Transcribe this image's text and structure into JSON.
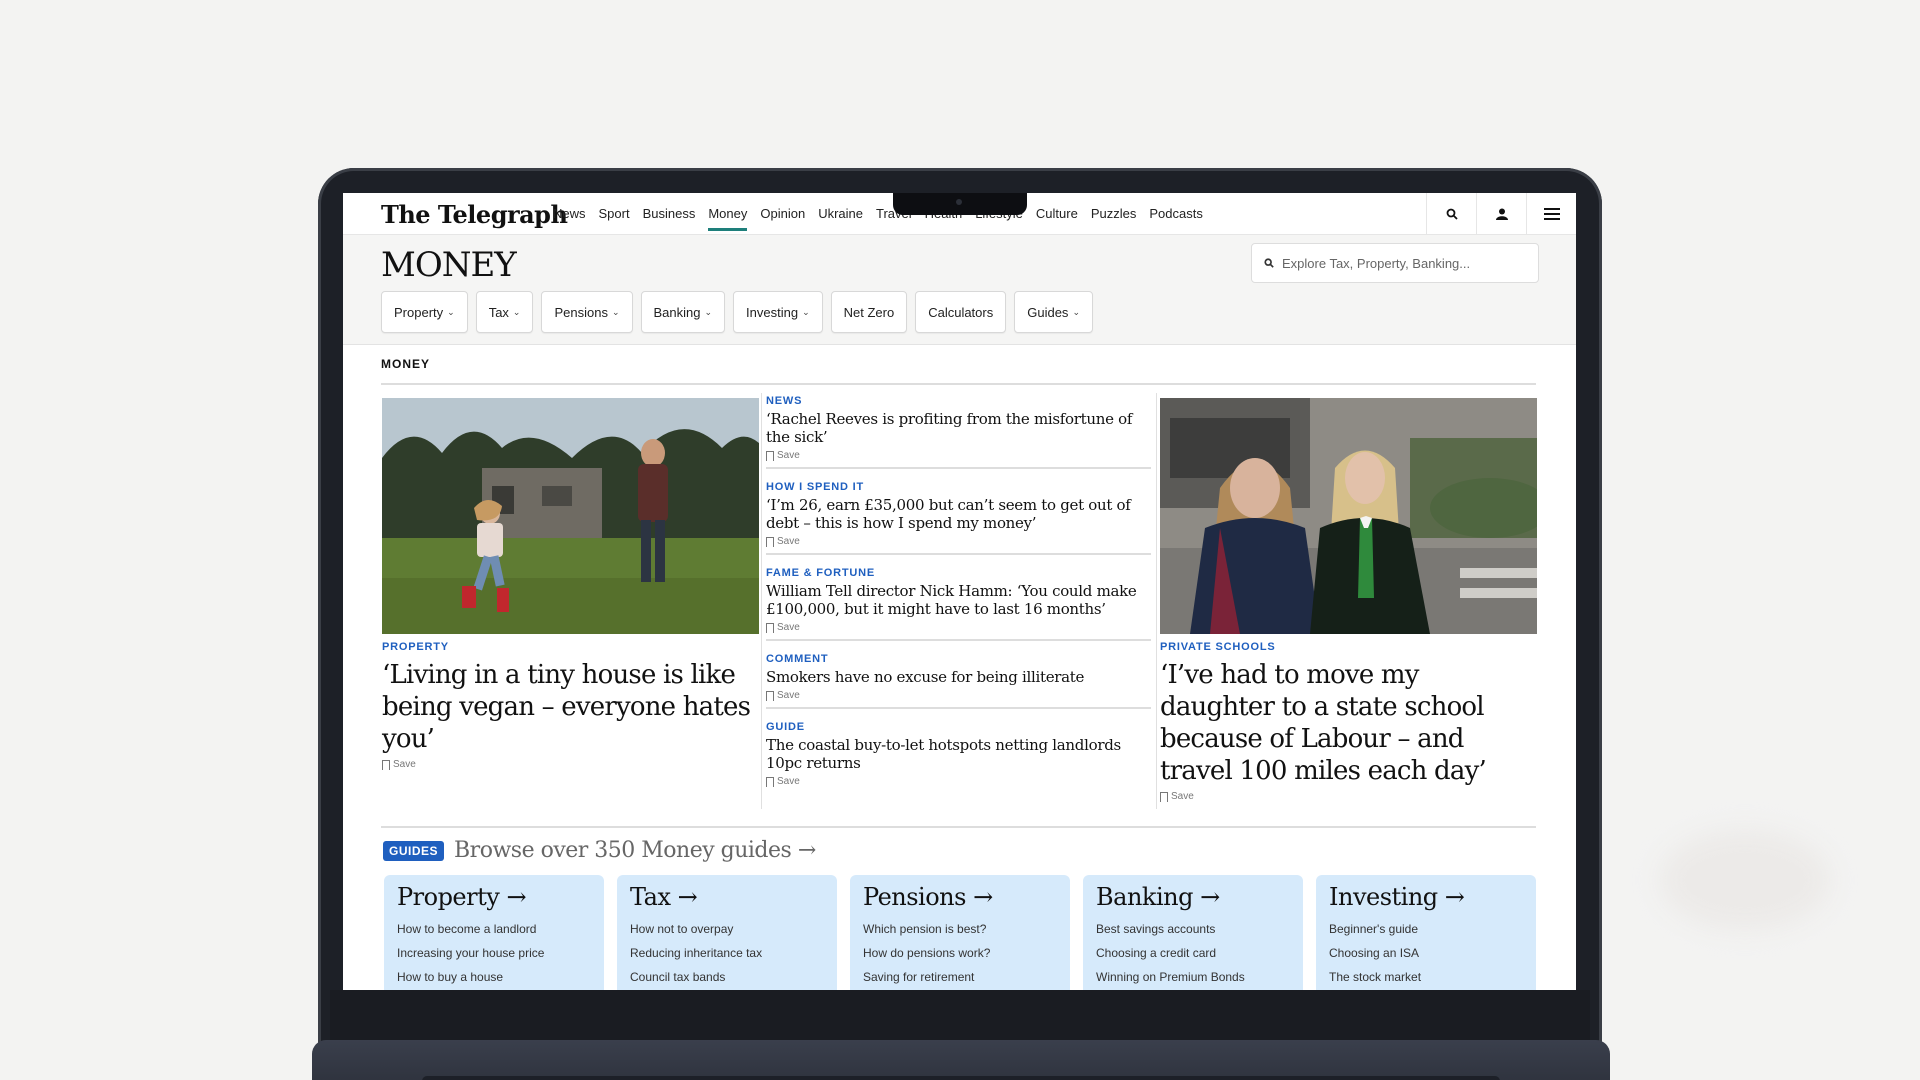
{
  "site": {
    "logo": "The Telegraph",
    "nav": [
      "News",
      "Sport",
      "Business",
      "Money",
      "Opinion",
      "Ukraine",
      "Travel",
      "Health",
      "Lifestyle",
      "Culture",
      "Puzzles",
      "Podcasts"
    ],
    "active_nav": "Money"
  },
  "money": {
    "title": "MONEY",
    "search_placeholder": "Explore Tax, Property, Banking...",
    "subnav": [
      {
        "label": "Property",
        "dropdown": true
      },
      {
        "label": "Tax",
        "dropdown": true
      },
      {
        "label": "Pensions",
        "dropdown": true
      },
      {
        "label": "Banking",
        "dropdown": true
      },
      {
        "label": "Investing",
        "dropdown": true
      },
      {
        "label": "Net Zero",
        "dropdown": false
      },
      {
        "label": "Calculators",
        "dropdown": false
      },
      {
        "label": "Guides",
        "dropdown": true
      }
    ]
  },
  "section_label": "MONEY",
  "save_label": "Save",
  "lead_left": {
    "kicker": "PROPERTY",
    "headline": "‘Living in a tiny house is like being vegan – everyone hates you’"
  },
  "lead_right": {
    "kicker": "PRIVATE SCHOOLS",
    "headline": "‘I’ve had to move my daughter to a state school because of Labour – and travel 100 miles each day’"
  },
  "stories": [
    {
      "kicker": "NEWS",
      "headline": "‘Rachel Reeves is profiting from the misfortune of the sick’"
    },
    {
      "kicker": "HOW I SPEND IT",
      "headline": "‘I’m 26, earn £35,000 but can’t seem to get out of debt – this is how I spend my money’"
    },
    {
      "kicker": "FAME & FORTUNE",
      "headline": "William Tell director Nick Hamm: ‘You could make £100,000, but it might have to last 16 months’"
    },
    {
      "kicker": "COMMENT",
      "headline": "Smokers have no excuse for being illiterate"
    },
    {
      "kicker": "GUIDE",
      "headline": "The coastal buy-to-let hotspots netting landlords 10pc returns"
    }
  ],
  "guides": {
    "badge": "GUIDES",
    "title": "Browse over 350 Money guides →",
    "cards": [
      {
        "title": "Property →",
        "links": [
          "How to become a landlord",
          "Increasing your house price",
          "How to buy a house"
        ]
      },
      {
        "title": "Tax →",
        "links": [
          "How not to overpay",
          "Reducing inheritance tax",
          "Council tax bands"
        ]
      },
      {
        "title": "Pensions →",
        "links": [
          "Which pension is best?",
          "How do pensions work?",
          "Saving for retirement"
        ]
      },
      {
        "title": "Banking →",
        "links": [
          "Best savings accounts",
          "Choosing a credit card",
          "Winning on Premium Bonds"
        ]
      },
      {
        "title": "Investing →",
        "links": [
          "Beginner's guide",
          "Choosing an ISA",
          "The stock market"
        ]
      }
    ]
  },
  "colors": {
    "accent_blue": "#1f5fbf",
    "nav_underline": "#1e7f7b",
    "guide_card": "#d6eafb"
  }
}
